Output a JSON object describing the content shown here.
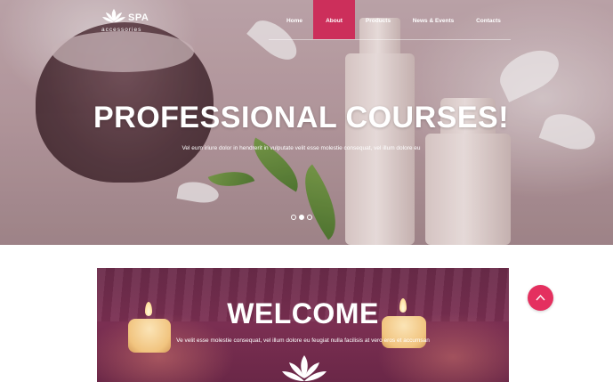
{
  "brand": {
    "name": "SPA",
    "tagline": "accessories",
    "logo_icon": "lotus-icon"
  },
  "nav": {
    "items": [
      {
        "label": "Home",
        "active": false
      },
      {
        "label": "About",
        "active": true
      },
      {
        "label": "Products",
        "active": false
      },
      {
        "label": "News & Events",
        "active": false
      },
      {
        "label": "Contacts",
        "active": false
      }
    ],
    "active_color": "#cc2f5b"
  },
  "hero": {
    "title": "PROFESSIONAL COURSES!",
    "subtitle": "Vel eum iriure dolor in hendrerit in vulputate velit esse molestie consequat, vel illum dolore eu",
    "slides": {
      "count": 3,
      "active": 2
    }
  },
  "welcome": {
    "title": "WELCOME",
    "subtitle": "Ve velit esse molestie consequat, vel illum dolore eu feugiat nulla facilisis at vero eros et accumsan",
    "icon": "lotus-icon"
  },
  "scroll_top": {
    "icon": "chevron-up-icon",
    "color": "#e4305f"
  }
}
